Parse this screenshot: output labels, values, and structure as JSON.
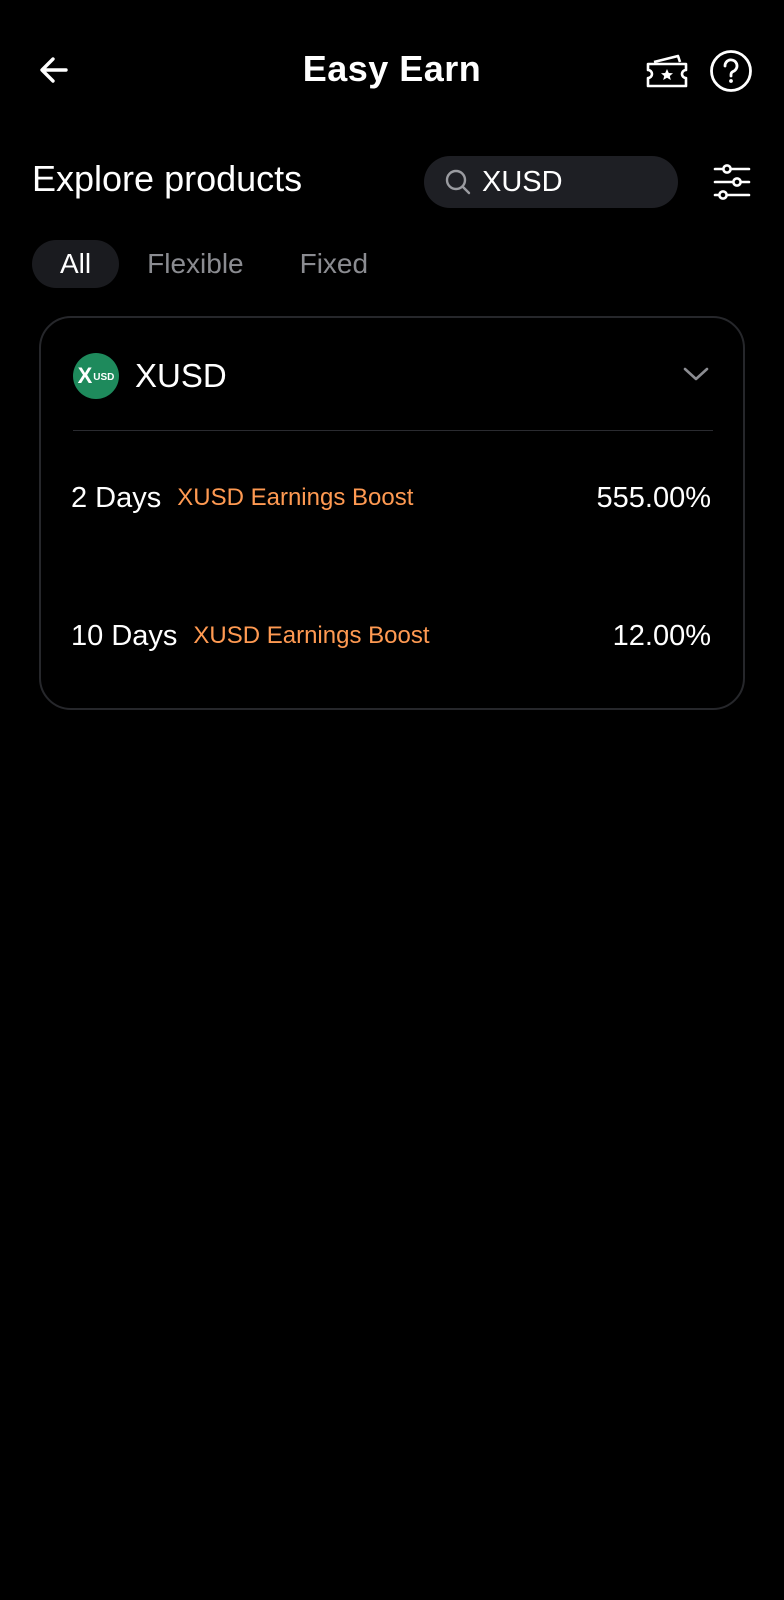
{
  "header": {
    "title": "Easy Earn",
    "back_icon": "arrow-left-icon",
    "voucher_icon": "ticket-star-icon",
    "help_icon": "question-circle-icon"
  },
  "explore": {
    "title": "Explore products",
    "search": {
      "value": "XUSD",
      "icon": "search-icon"
    },
    "filter_icon": "sliders-icon"
  },
  "tabs": [
    {
      "label": "All",
      "active": true
    },
    {
      "label": "Flexible",
      "active": false
    },
    {
      "label": "Fixed",
      "active": false
    }
  ],
  "asset": {
    "name": "XUSD",
    "logo_text_big": "X",
    "logo_text_small": "USD",
    "logo_color": "#1e8a5c",
    "products": [
      {
        "term": "2 Days",
        "tag": "XUSD Earnings Boost",
        "apr": "555.00%"
      },
      {
        "term": "10 Days",
        "tag": "XUSD Earnings Boost",
        "apr": "12.00%"
      }
    ]
  },
  "colors": {
    "background": "#000000",
    "accent_orange": "#ff9a52",
    "card_border": "#26272b",
    "muted_text": "#8b8c91"
  }
}
